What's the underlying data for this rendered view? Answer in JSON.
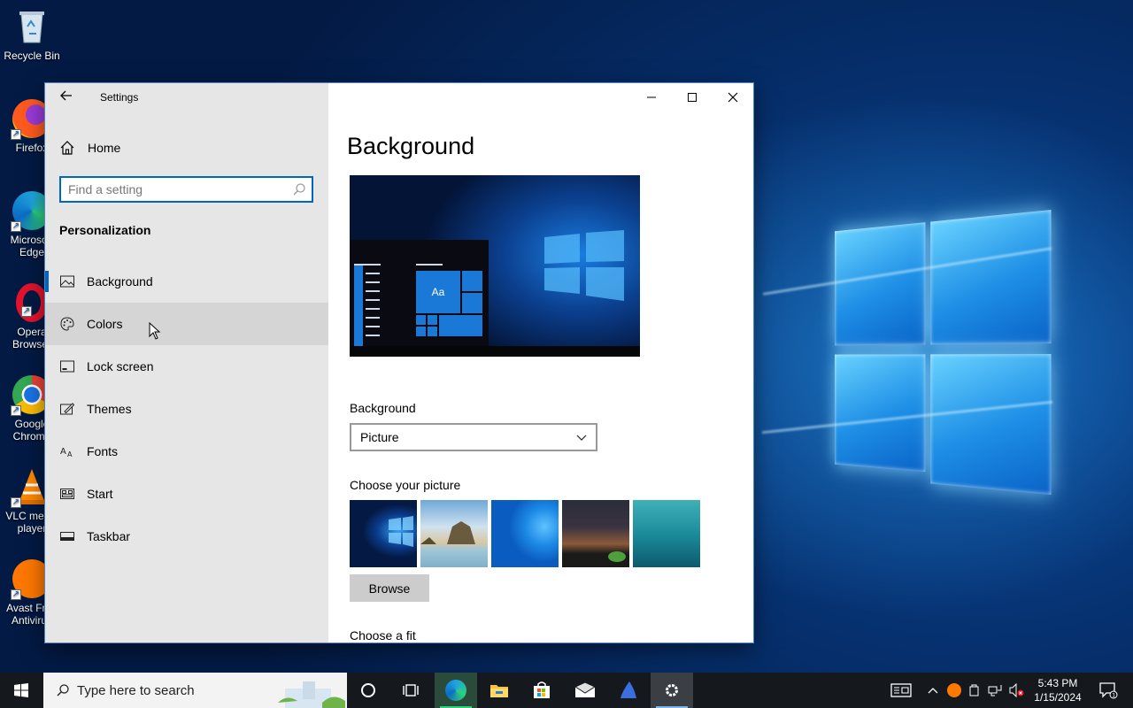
{
  "desktop": {
    "icons": [
      {
        "label": "Recycle Bin"
      },
      {
        "label": "Firefox"
      },
      {
        "label": "Microsoft Edge"
      },
      {
        "label": "Opera Browser"
      },
      {
        "label": "Google Chrome"
      },
      {
        "label": "VLC media player"
      },
      {
        "label": "Avast Free Antivirus"
      }
    ]
  },
  "settings": {
    "app_title": "Settings",
    "home_label": "Home",
    "search_placeholder": "Find a setting",
    "section_title": "Personalization",
    "nav": [
      {
        "label": "Background",
        "icon": "picture-icon"
      },
      {
        "label": "Colors",
        "icon": "palette-icon"
      },
      {
        "label": "Lock screen",
        "icon": "lock-screen-icon"
      },
      {
        "label": "Themes",
        "icon": "themes-icon"
      },
      {
        "label": "Fonts",
        "icon": "fonts-icon"
      },
      {
        "label": "Start",
        "icon": "start-icon"
      },
      {
        "label": "Taskbar",
        "icon": "taskbar-icon"
      }
    ],
    "page_title": "Background",
    "preview_tile_text": "Aa",
    "background_label": "Background",
    "background_value": "Picture",
    "choose_picture_label": "Choose your picture",
    "browse_label": "Browse",
    "choose_fit_label": "Choose a fit"
  },
  "taskbar": {
    "search_placeholder": "Type here to search",
    "time": "5:43 PM",
    "date": "1/15/2024"
  },
  "colors": {
    "accent": "#0067c0",
    "sidebar_bg": "#e6e6e6",
    "taskbar_bg": "#15191e"
  }
}
